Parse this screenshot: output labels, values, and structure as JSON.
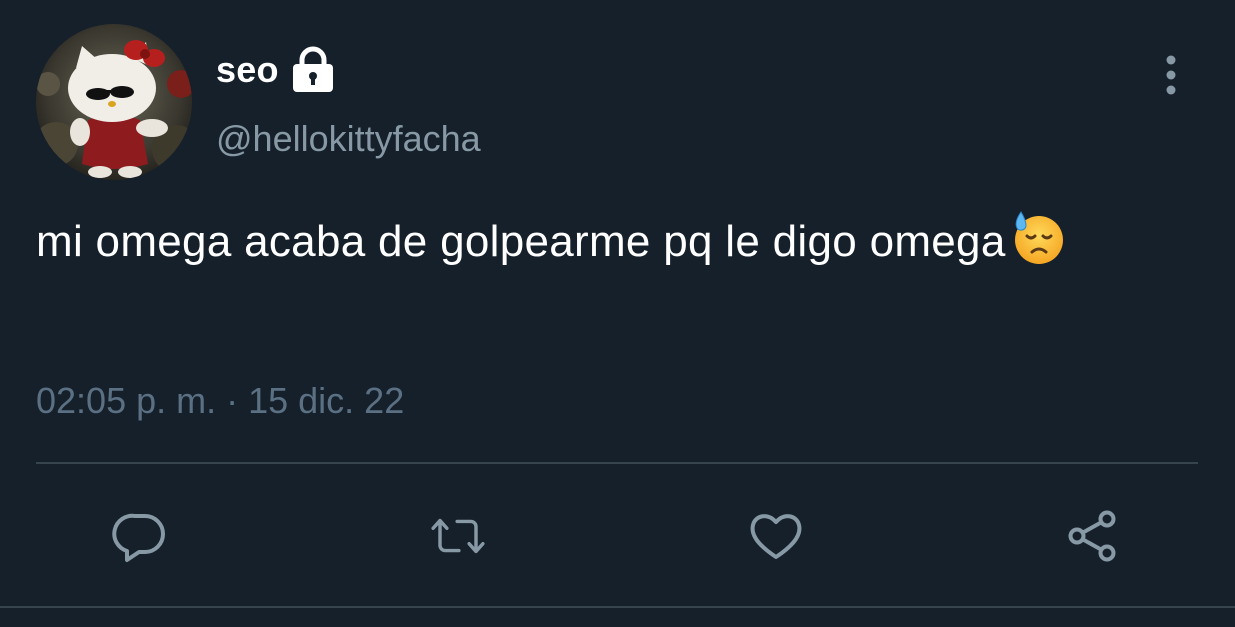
{
  "tweet": {
    "display_name": "seo",
    "handle": "@hellokittyfacha",
    "text": "mi omega acaba de golpearme pq le digo omega",
    "timestamp": "02:05 p. m. · 15 dic. 22",
    "protected": true,
    "emoji": "downcast-face-with-sweat"
  },
  "icons": {
    "lock": "lock-icon",
    "more": "more-vertical-icon",
    "reply": "reply-icon",
    "retweet": "retweet-icon",
    "like": "heart-icon",
    "share": "share-icon"
  },
  "colors": {
    "background": "#15202b",
    "text": "#ffffff",
    "secondary_text": "#8899a6",
    "timestamp": "#5b7083",
    "divider": "#38444d"
  }
}
